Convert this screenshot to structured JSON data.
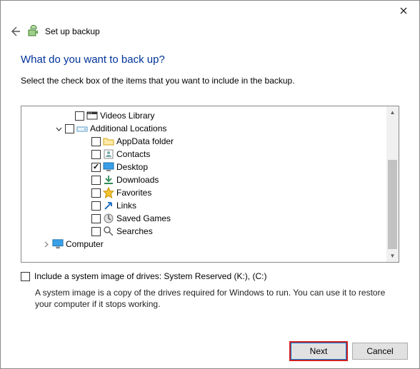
{
  "titlebar": {
    "close": "✕"
  },
  "header": {
    "title": "Set up backup"
  },
  "question": "What do you want to back up?",
  "instruction": "Select the check box of the items that you want to include in the backup.",
  "tree": {
    "videos": "Videos Library",
    "additional": "Additional Locations",
    "items": {
      "appdata": "AppData folder",
      "contacts": "Contacts",
      "desktop": "Desktop",
      "downloads": "Downloads",
      "favorites": "Favorites",
      "links": "Links",
      "saved": "Saved Games",
      "searches": "Searches"
    },
    "computer": "Computer"
  },
  "sysimage": {
    "label": "Include a system image of drives: System Reserved (K:), (C:)",
    "desc": "A system image is a copy of the drives required for Windows to run. You can use it to restore your computer if it stops working."
  },
  "buttons": {
    "next": "Next",
    "cancel": "Cancel"
  }
}
